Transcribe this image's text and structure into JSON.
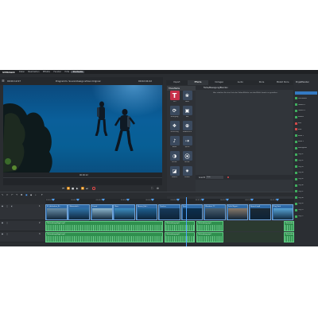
{
  "app": {
    "brand": "VPMAGIX",
    "menus": [
      "Datei",
      "Bearbeiten",
      "Effekte",
      "Fenster",
      "Hilfe",
      "Startseite"
    ],
    "active_menu_index": 5
  },
  "preview": {
    "timecode_left": "00:00:12:07",
    "title": "Programm: Sound-Design-Video Original",
    "timecode_right": "00:02:04:22",
    "below_video_label": "00:00:12",
    "transport_icons": [
      "skip-start-icon",
      "step-back-icon",
      "stop-icon",
      "play-icon",
      "step-forward-icon",
      "skip-end-icon",
      "record-icon"
    ]
  },
  "effects": {
    "tabs": [
      "Import",
      "Effekte",
      "Vorlagen",
      "Audio",
      "Store",
      "MAGIX Store"
    ],
    "active_tab_index": 1,
    "category_title": "Titeleffekte",
    "tiles": [
      {
        "name": "Titel",
        "icon": "title-icon"
      },
      {
        "name": "Farbe",
        "icon": "color-wheel-icon"
      },
      {
        "name": "Bewegung",
        "icon": "motion-icon"
      },
      {
        "name": "Bild",
        "icon": "image-icon"
      },
      {
        "name": "Stilisierung",
        "icon": "stylize-icon"
      },
      {
        "name": "Stabilisieren",
        "icon": "stabilize-icon"
      },
      {
        "name": "Audio",
        "icon": "audio-icon"
      },
      {
        "name": "Speed",
        "icon": "speed-icon"
      },
      {
        "name": "Blende",
        "icon": "fade-icon"
      },
      {
        "name": "Blende",
        "icon": "blend-icon"
      },
      {
        "name": "Masken",
        "icon": "mask-icon"
      },
      {
        "name": "Schärfe",
        "icon": "sharpen-icon"
      }
    ],
    "detail_title": "Farbe/Bewegung/Blenden",
    "detail_description": "Hier erhalten Sie eine Liste der Video-Effekte, um das Effekt kreativ zu gestalten.",
    "bottom_label": "Ansicht",
    "bottom_select": "Liste",
    "timeline_label": "Clip-Auswahl: Unterwasser.mp4"
  },
  "browser": {
    "title": "Projektfenster",
    "items": [
      {
        "name": "Unterwasser",
        "color": "#3fae5e"
      },
      {
        "name": "Tauchen 1",
        "color": "#3fae5e"
      },
      {
        "name": "Tauchen 2",
        "color": "#3fae5e"
      },
      {
        "name": "Korallen",
        "color": "#3fae5e"
      },
      {
        "name": "Intro",
        "color": "#d04a4a"
      },
      {
        "name": "Ende",
        "color": "#d04a4a"
      },
      {
        "name": "Musik 1",
        "color": "#3fae5e"
      },
      {
        "name": "Musik 2",
        "color": "#3fae5e"
      },
      {
        "name": "Hintergrund",
        "color": "#3fae5e"
      },
      {
        "name": "Clip_01",
        "color": "#3fae5e"
      },
      {
        "name": "Clip_02",
        "color": "#3fae5e"
      },
      {
        "name": "Clip_03",
        "color": "#3fae5e"
      },
      {
        "name": "Clip_04",
        "color": "#3fae5e"
      },
      {
        "name": "Clip_05",
        "color": "#3fae5e"
      },
      {
        "name": "Clip_06",
        "color": "#3fae5e"
      },
      {
        "name": "Clip_07",
        "color": "#3fae5e"
      },
      {
        "name": "Clip_08",
        "color": "#3fae5e"
      },
      {
        "name": "Clip_09",
        "color": "#3fae5e"
      },
      {
        "name": "Clip_10",
        "color": "#3fae5e"
      },
      {
        "name": "Clip_11",
        "color": "#3fae5e"
      }
    ]
  },
  "timeline": {
    "ruler_ticks": [
      "00:00:00",
      "00:00:10",
      "00:00:20",
      "00:00:30",
      "00:00:40",
      "00:00:50",
      "00:01:00",
      "00:01:10",
      "00:01:20",
      "00:01:30"
    ],
    "tracks": [
      {
        "num": "1",
        "type": "video"
      },
      {
        "num": "2",
        "type": "audio"
      },
      {
        "num": "3",
        "type": "audio"
      }
    ],
    "video_clips": [
      {
        "label": "01_Aufnahme_Ri...",
        "color": "#2f6aa6"
      },
      {
        "label": "Wasserdreh...",
        "color": "#2f6aa6"
      },
      {
        "label": "Strand",
        "color": "#2f6aa6"
      },
      {
        "label": "Meer",
        "color": "#2f6aa6"
      },
      {
        "label": "Wasser_Dok...",
        "color": "#2f6aa6"
      },
      {
        "label": "Taucher",
        "color": "#2f6aa6"
      },
      {
        "label": "Tauc...",
        "color": "#2f6aa6"
      },
      {
        "label": "Wanderer TC",
        "color": "#2f6aa6"
      },
      {
        "label": "Turtle Migrat...",
        "color": "#2f6aa6"
      },
      {
        "label": "Bewertl.mp4",
        "color": "#2f6aa6"
      },
      {
        "label": "Plug_Dark",
        "color": "#2f6aa6"
      }
    ],
    "audio_clips_track2": [
      "Ohrkundung-Hagel.mp3",
      "Ohrkundung.mp3",
      "Ohrkundung.mp3",
      "Ohrkundung.mp3"
    ],
    "audio_clips_track3": [
      "Ohrkundung-Hagel.mp3",
      "Ohrkundung.mp3",
      "Ohrkundung.mp3",
      "Ohrkundung.mp3"
    ]
  }
}
